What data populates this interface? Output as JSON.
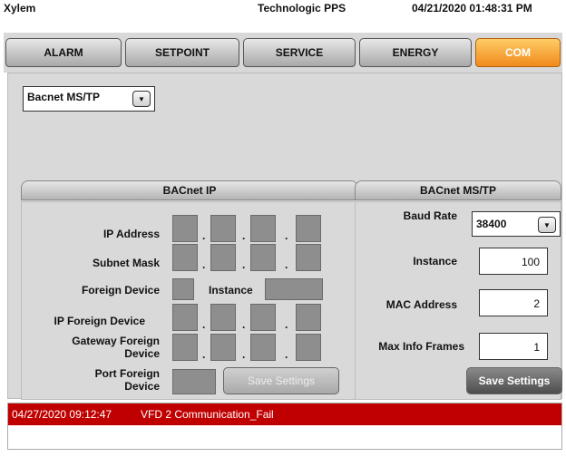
{
  "header": {
    "app": "Xylem",
    "device": "Technologic PPS",
    "datetime": "04/21/2020 01:48:31 PM"
  },
  "tabs": [
    {
      "label": "ALARM",
      "active": false
    },
    {
      "label": "SETPOINT",
      "active": false
    },
    {
      "label": "SERVICE",
      "active": false
    },
    {
      "label": "ENERGY",
      "active": false
    },
    {
      "label": "COM",
      "active": true
    }
  ],
  "protocol": {
    "selected": "Bacnet MS/TP",
    "icon": "dropdown-arrow-icon"
  },
  "bacnet_ip": {
    "title": "BACnet IP",
    "ip_address_label": "IP Address",
    "subnet_mask_label": "Subnet Mask",
    "foreign_device_label": "Foreign Device",
    "instance_label": "Instance",
    "ip_foreign_device_label": "IP Foreign Device",
    "gateway_foreign_device_label": "Gateway Foreign Device",
    "port_foreign_device_label": "Port Foreign Device",
    "save_label": "Save Settings",
    "separator": "."
  },
  "bacnet_mstp": {
    "title": "BACnet MS/TP",
    "baud_rate_label": "Baud Rate",
    "baud_rate_value": "38400",
    "instance_label": "Instance",
    "instance_value": "100",
    "mac_address_label": "MAC Address",
    "mac_address_value": "2",
    "max_info_frames_label": "Max Info Frames",
    "max_info_frames_value": "1",
    "save_label": "Save Settings"
  },
  "alarm": {
    "timestamp": "04/27/2020 09:12:47",
    "message": "VFD 2 Communication_Fail",
    "color": "#c00000"
  },
  "colors": {
    "active_tab": "#f08a1c",
    "disabled_field": "#8e8e8e"
  }
}
